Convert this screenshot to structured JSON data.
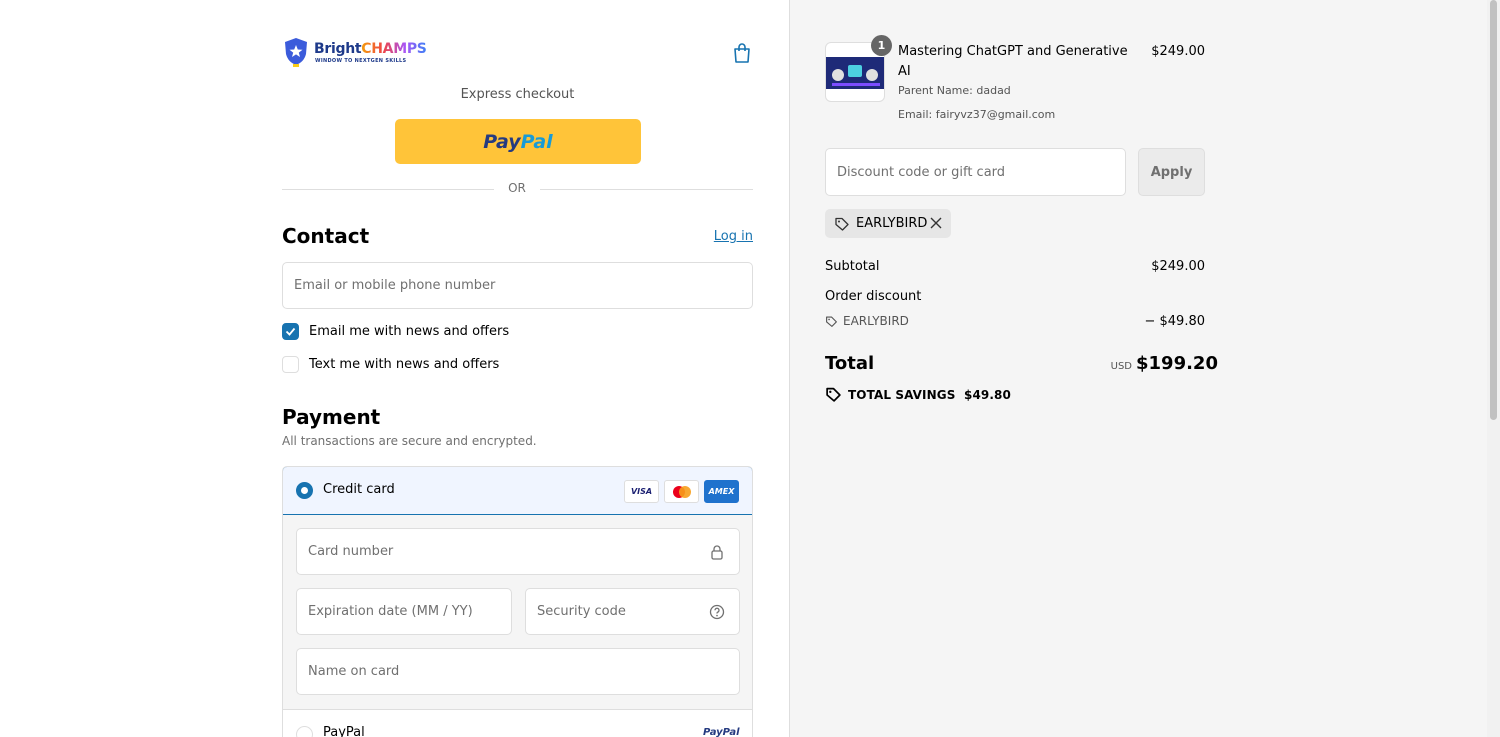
{
  "brand": {
    "name_part1": "Bright",
    "name_part2": "CHAMPS",
    "tagline": "WINDOW TO NEXTGEN SKILLS"
  },
  "express": {
    "label": "Express checkout",
    "paypal_part1": "Pay",
    "paypal_part2": "Pal",
    "or_label": "OR"
  },
  "contact": {
    "title": "Contact",
    "login_link": "Log in",
    "email_placeholder": "Email or mobile phone number",
    "email_offers_label": "Email me with news and offers",
    "email_offers_checked": true,
    "text_offers_label": "Text me with news and offers",
    "text_offers_checked": false
  },
  "payment": {
    "title": "Payment",
    "subtitle": "All transactions are secure and encrypted.",
    "credit_card_label": "Credit card",
    "card_logos": [
      "VISA",
      "Mastercard",
      "AMEX"
    ],
    "card_number_placeholder": "Card number",
    "expiration_placeholder": "Expiration date (MM / YY)",
    "security_code_placeholder": "Security code",
    "name_on_card_placeholder": "Name on card",
    "paypal_label": "PayPal",
    "paypal_logo": "PayPal"
  },
  "order": {
    "item": {
      "quantity": "1",
      "name": "Mastering ChatGPT and Generative AI",
      "price": "$249.00",
      "parent_name": "Parent Name: dadad",
      "email": "Email: fairyvz37@gmail.com"
    },
    "discount_placeholder": "Discount code or gift card",
    "apply_label": "Apply",
    "applied_code": "EARLYBIRD",
    "subtotal_label": "Subtotal",
    "subtotal_value": "$249.00",
    "order_discount_label": "Order discount",
    "discount_code": "EARLYBIRD",
    "discount_value": "− $49.80",
    "total_label": "Total",
    "total_currency": "USD",
    "total_value": "$199.20",
    "savings_label": "TOTAL SAVINGS",
    "savings_value": "$49.80"
  },
  "colors": {
    "accent": "#1773b0",
    "paypal_yellow": "#ffc439",
    "summary_bg": "#f5f5f5"
  }
}
